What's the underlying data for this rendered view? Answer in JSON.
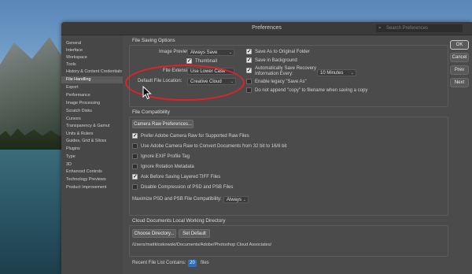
{
  "window": {
    "title": "Preferences"
  },
  "search": {
    "placeholder": "Search Preferences",
    "icon": "search-icon"
  },
  "sidebar": {
    "items": [
      {
        "label": "General"
      },
      {
        "label": "Interface"
      },
      {
        "label": "Workspace"
      },
      {
        "label": "Tools"
      },
      {
        "label": "History & Content Credentials"
      },
      {
        "label": "File Handling",
        "selected": true
      },
      {
        "label": "Export"
      },
      {
        "label": "Performance"
      },
      {
        "label": "Image Processing"
      },
      {
        "label": "Scratch Disks"
      },
      {
        "label": "Cursors"
      },
      {
        "label": "Transparency & Gamut"
      },
      {
        "label": "Units & Rulers"
      },
      {
        "label": "Guides, Grid & Slices"
      },
      {
        "label": "Plugins"
      },
      {
        "label": "Type"
      },
      {
        "label": "3D"
      },
      {
        "label": "Enhanced Controls"
      },
      {
        "label": "Technology Previews"
      },
      {
        "label": "Product Improvement"
      }
    ]
  },
  "file_saving": {
    "title": "File Saving Options",
    "image_previews_label": "Image Previews:",
    "image_previews_value": "Always Save",
    "thumbnail_label": "Thumbnail",
    "thumbnail_checked": true,
    "file_extension_label": "File Extension:",
    "file_extension_value": "Use Lower Case",
    "default_location_label": "Default File Location:",
    "default_location_value": "Creative Cloud",
    "save_as_original_label": "Save As to Original Folder",
    "save_as_original_checked": true,
    "save_background_label": "Save in Background",
    "save_background_checked": true,
    "auto_recovery_label_1": "Automatically Save Recovery",
    "auto_recovery_label_2": "Information Every:",
    "auto_recovery_checked": true,
    "auto_recovery_value": "10 Minutes",
    "legacy_save_as_label": "Enable legacy \"Save As\"",
    "legacy_save_as_checked": false,
    "no_copy_label": "Do not append \"copy\" to filename when saving a copy",
    "no_copy_checked": false
  },
  "file_compat": {
    "title": "File Compatibility",
    "camera_raw_button": "Camera Raw Preferences...",
    "options": [
      {
        "label": "Prefer Adobe Camera Raw for Supported Raw Files",
        "checked": true
      },
      {
        "label": "Use Adobe Camera Raw to Convert Documents from 32 bit to 16/8 bit",
        "checked": false
      },
      {
        "label": "Ignore EXIF Profile Tag",
        "checked": false
      },
      {
        "label": "Ignore Rotation Metadata",
        "checked": false
      },
      {
        "label": "Ask Before Saving Layered TIFF Files",
        "checked": true
      },
      {
        "label": "Disable Compression of PSD and PSB Files",
        "checked": false
      }
    ],
    "maximize_label": "Maximize PSD and PSB File Compatibility:",
    "maximize_value": "Always"
  },
  "cloud_dir": {
    "title": "Cloud Documents Local Working Directory",
    "choose_button": "Choose Directory...",
    "default_button": "Set Default",
    "path": "/Users/mattkloskowski/Documents/Adobe/Photoshop Cloud Associates/"
  },
  "recent": {
    "label": "Recent File List Contains:",
    "value": "20",
    "suffix": "files"
  },
  "actions": {
    "ok": "OK",
    "cancel": "Cancel",
    "prev": "Prev",
    "next": "Next"
  },
  "annotation_color": "#e3212b"
}
